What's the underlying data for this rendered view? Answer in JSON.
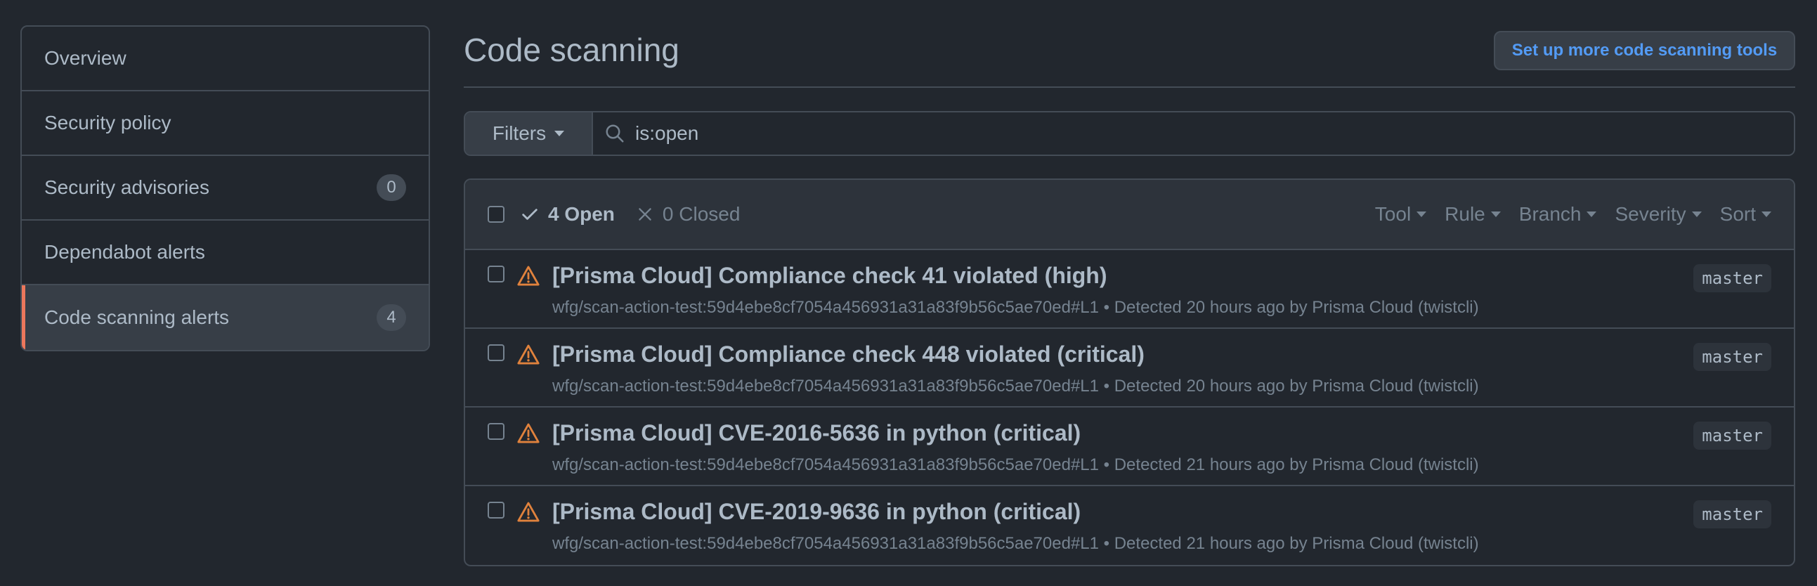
{
  "sidebar": {
    "items": [
      {
        "label": "Overview",
        "count": null
      },
      {
        "label": "Security policy",
        "count": null
      },
      {
        "label": "Security advisories",
        "count": "0"
      },
      {
        "label": "Dependabot alerts",
        "count": null
      },
      {
        "label": "Code scanning alerts",
        "count": "4",
        "active": true
      }
    ]
  },
  "header": {
    "title": "Code scanning",
    "setup_button": "Set up more code scanning tools"
  },
  "filter": {
    "button_label": "Filters",
    "query": "is:open"
  },
  "alerts": {
    "open_label": "4 Open",
    "closed_label": "0 Closed",
    "menus": [
      "Tool",
      "Rule",
      "Branch",
      "Severity",
      "Sort"
    ],
    "rows": [
      {
        "title": "[Prisma Cloud] Compliance check 41 violated (high)",
        "meta": "wfg/scan-action-test:59d4ebe8cf7054a456931a31a83f9b56c5ae70ed#L1 • Detected 20 hours ago by Prisma Cloud (twistcli)",
        "branch": "master"
      },
      {
        "title": "[Prisma Cloud] Compliance check 448 violated (critical)",
        "meta": "wfg/scan-action-test:59d4ebe8cf7054a456931a31a83f9b56c5ae70ed#L1 • Detected 20 hours ago by Prisma Cloud (twistcli)",
        "branch": "master"
      },
      {
        "title": "[Prisma Cloud] CVE-2016-5636 in python (critical)",
        "meta": "wfg/scan-action-test:59d4ebe8cf7054a456931a31a83f9b56c5ae70ed#L1 • Detected 21 hours ago by Prisma Cloud (twistcli)",
        "branch": "master"
      },
      {
        "title": "[Prisma Cloud] CVE-2019-9636 in python (critical)",
        "meta": "wfg/scan-action-test:59d4ebe8cf7054a456931a31a83f9b56c5ae70ed#L1 • Detected 21 hours ago by Prisma Cloud (twistcli)",
        "branch": "master"
      }
    ]
  },
  "colors": {
    "background": "#22272e",
    "border": "#444c56",
    "accent_active": "#ec775c",
    "link": "#539bf5",
    "warning": "#e0823d"
  },
  "icons": {
    "search": "search-icon",
    "check": "check-icon",
    "close": "x-icon",
    "alert": "alert-triangle-icon",
    "caret": "caret-down-icon"
  }
}
